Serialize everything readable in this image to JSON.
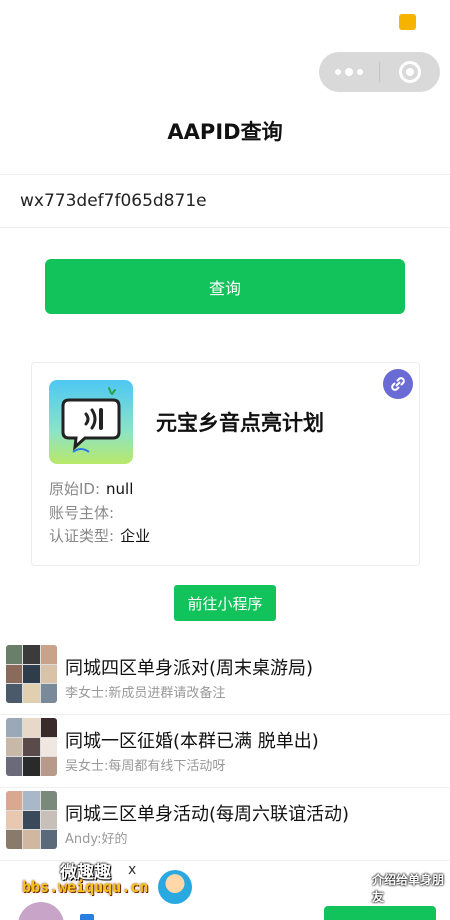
{
  "header": {
    "title": "AAPID查询"
  },
  "search": {
    "value": "wx773def7f065d871e",
    "placeholder": ""
  },
  "query_button": {
    "label": "查询"
  },
  "result_card": {
    "app_name": "元宝乡音点亮计划",
    "icon": "speech-bubble-sound-icon",
    "link_icon": "link-icon",
    "rows": [
      {
        "label": "原始ID:",
        "value": "null"
      },
      {
        "label": "账号主体:",
        "value": ""
      },
      {
        "label": "认证类型:",
        "value": "企业"
      }
    ]
  },
  "goto_button": {
    "label": "前往小程序"
  },
  "groups": [
    {
      "title": "同城四区单身派对(周末桌游局)",
      "subtitle": "李女士:新成员进群请改备注"
    },
    {
      "title": "同城一区征婚(本群已满 脱单出)",
      "subtitle": "吴女士:每周都有线下活动呀"
    },
    {
      "title": "同城三区单身活动(每周六联谊活动)",
      "subtitle": "Andy:好的"
    }
  ],
  "watermark": {
    "left_text": "微趣趣",
    "url": "bbs.weiququ.cn",
    "right_text": "介绍给单身朋友",
    "x_mark": "x"
  },
  "colors": {
    "primary_green": "#12c25a",
    "link_badge": "#6b6bd6",
    "status_yellow": "#f6b400"
  }
}
